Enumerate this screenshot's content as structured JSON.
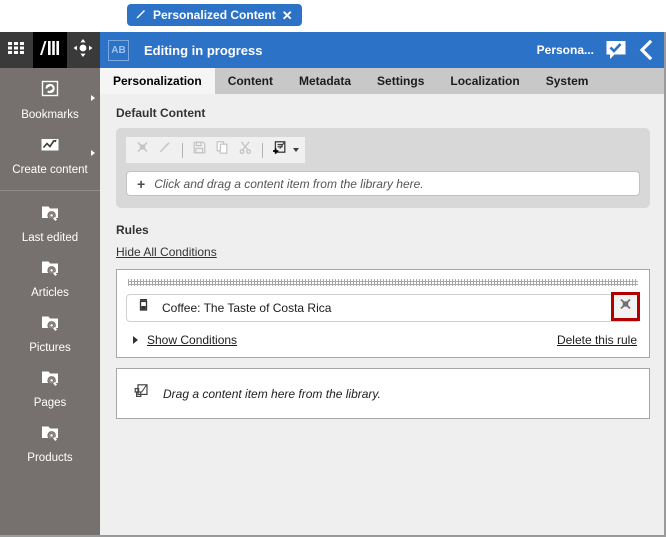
{
  "pill_tab": {
    "label": "Personalized Content",
    "edit_icon": "pencil-icon",
    "close_icon": "close-icon"
  },
  "rail": {
    "top_buttons": [
      {
        "name": "app-grid-button",
        "icon": "grid-icon"
      },
      {
        "name": "logo-button",
        "icon": "books-logo-icon"
      },
      {
        "name": "move-button",
        "icon": "four-way-arrow-icon"
      }
    ],
    "groups": [
      {
        "items": [
          {
            "label": "Bookmarks",
            "icon": "bookmarks-refresh-icon",
            "has_caret": true
          },
          {
            "label": "Create content",
            "icon": "create-content-chart-icon",
            "has_caret": true
          }
        ]
      },
      {
        "items": [
          {
            "label": "Last edited",
            "icon": "folder-search-icon",
            "has_caret": false
          },
          {
            "label": "Articles",
            "icon": "folder-search-icon",
            "has_caret": false
          },
          {
            "label": "Pictures",
            "icon": "folder-search-icon",
            "has_caret": false
          },
          {
            "label": "Pages",
            "icon": "folder-search-icon",
            "has_caret": false
          },
          {
            "label": "Products",
            "icon": "folder-search-icon",
            "has_caret": false
          }
        ]
      }
    ]
  },
  "header": {
    "badge": "AB",
    "title": "Editing in progress",
    "user": "Persona...",
    "check_icon": "check-speech-bubble-icon",
    "back_icon": "chevron-left-icon",
    "accent_color": "#2c72c7"
  },
  "tabs": [
    {
      "label": "Personalization",
      "active": true
    },
    {
      "label": "Content",
      "active": false
    },
    {
      "label": "Metadata",
      "active": false
    },
    {
      "label": "Settings",
      "active": false
    },
    {
      "label": "Localization",
      "active": false
    },
    {
      "label": "System",
      "active": false
    }
  ],
  "default_content": {
    "section_label": "Default Content",
    "toolbar": [
      {
        "name": "delete-button",
        "icon": "x-delete-icon",
        "disabled": true
      },
      {
        "name": "edit-button",
        "icon": "pencil-icon",
        "disabled": true
      },
      {
        "name": "separator-1",
        "icon": "separator"
      },
      {
        "name": "save-button",
        "icon": "floppy-save-icon",
        "disabled": true
      },
      {
        "name": "copy-button",
        "icon": "copy-icon",
        "disabled": true
      },
      {
        "name": "cut-button",
        "icon": "scissors-cut-icon",
        "disabled": true
      },
      {
        "name": "separator-2",
        "icon": "separator"
      },
      {
        "name": "new-content-button",
        "icon": "new-document-plus-icon",
        "disabled": false
      }
    ],
    "dropzone_plus": "+",
    "dropzone_text": "Click and drag a content item from the library here."
  },
  "rules": {
    "section_label": "Rules",
    "hide_all_conditions": "Hide All Conditions",
    "rule": {
      "item_icon": "content-item-icon",
      "item_text": "Coffee: The Taste of Costa Rica",
      "delete_item_icon": "x-delete-icon",
      "delete_item_highlight_color": "#b00000",
      "show_conditions": "Show Conditions",
      "delete_rule": "Delete this rule",
      "drop_icon": "drag-content-icon",
      "drop_text": "Drag a content item here from the library."
    }
  }
}
